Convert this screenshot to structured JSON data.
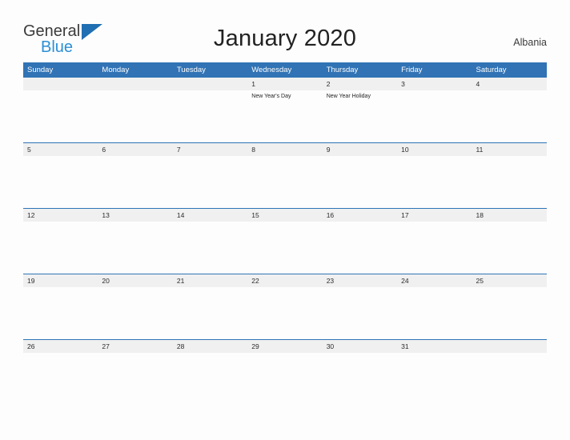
{
  "brand": {
    "name_part1": "General",
    "name_part2": "Blue",
    "flag_icon": "triangle-flag-icon",
    "colors": {
      "part1": "#3b3b3b",
      "part2": "#2b8fd6",
      "flag": "#1f6fb2"
    }
  },
  "header": {
    "title": "January 2020",
    "region": "Albania"
  },
  "theme": {
    "header_blue": "#3173b5",
    "separator_blue": "#2f74b5",
    "date_band_gray": "#f0f0f0",
    "page_background": "#fdfdfd"
  },
  "calendar": {
    "weekdays": [
      "Sunday",
      "Monday",
      "Tuesday",
      "Wednesday",
      "Thursday",
      "Friday",
      "Saturday"
    ],
    "weeks": [
      {
        "days": [
          {
            "date": "",
            "events": []
          },
          {
            "date": "",
            "events": []
          },
          {
            "date": "",
            "events": []
          },
          {
            "date": "1",
            "events": [
              "New Year's Day"
            ]
          },
          {
            "date": "2",
            "events": [
              "New Year Holiday"
            ]
          },
          {
            "date": "3",
            "events": []
          },
          {
            "date": "4",
            "events": []
          }
        ]
      },
      {
        "days": [
          {
            "date": "5",
            "events": []
          },
          {
            "date": "6",
            "events": []
          },
          {
            "date": "7",
            "events": []
          },
          {
            "date": "8",
            "events": []
          },
          {
            "date": "9",
            "events": []
          },
          {
            "date": "10",
            "events": []
          },
          {
            "date": "11",
            "events": []
          }
        ]
      },
      {
        "days": [
          {
            "date": "12",
            "events": []
          },
          {
            "date": "13",
            "events": []
          },
          {
            "date": "14",
            "events": []
          },
          {
            "date": "15",
            "events": []
          },
          {
            "date": "16",
            "events": []
          },
          {
            "date": "17",
            "events": []
          },
          {
            "date": "18",
            "events": []
          }
        ]
      },
      {
        "days": [
          {
            "date": "19",
            "events": []
          },
          {
            "date": "20",
            "events": []
          },
          {
            "date": "21",
            "events": []
          },
          {
            "date": "22",
            "events": []
          },
          {
            "date": "23",
            "events": []
          },
          {
            "date": "24",
            "events": []
          },
          {
            "date": "25",
            "events": []
          }
        ]
      },
      {
        "days": [
          {
            "date": "26",
            "events": []
          },
          {
            "date": "27",
            "events": []
          },
          {
            "date": "28",
            "events": []
          },
          {
            "date": "29",
            "events": []
          },
          {
            "date": "30",
            "events": []
          },
          {
            "date": "31",
            "events": []
          },
          {
            "date": "",
            "events": []
          }
        ]
      }
    ]
  }
}
